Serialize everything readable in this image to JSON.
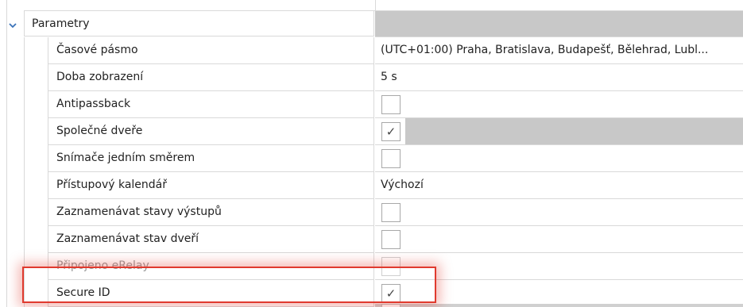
{
  "section": {
    "title": "Parametry",
    "expanded": true,
    "chevron_icon": "chevron-down-icon"
  },
  "rows": [
    {
      "key": "timezone",
      "label": "Časové pásmo",
      "type": "text",
      "value": "(UTC+01:00) Praha, Bratislava, Budapešť, Bělehrad, Lubl..."
    },
    {
      "key": "display-time",
      "label": "Doba zobrazení",
      "type": "text",
      "value": "5 s"
    },
    {
      "key": "antipassback",
      "label": "Antipassback",
      "type": "checkbox",
      "checked": false
    },
    {
      "key": "shared-door",
      "label": "Společné dveře",
      "type": "checkbox",
      "checked": true,
      "shaded": true
    },
    {
      "key": "one-way-readers",
      "label": "Snímače jedním směrem",
      "type": "checkbox",
      "checked": false
    },
    {
      "key": "access-calendar",
      "label": "Přístupový kalendář",
      "type": "text",
      "value": "Výchozí"
    },
    {
      "key": "log-output-states",
      "label": "Zaznamenávat stavy výstupů",
      "type": "checkbox",
      "checked": false
    },
    {
      "key": "log-door-state",
      "label": "Zaznamenávat stav dveří",
      "type": "checkbox",
      "checked": false
    },
    {
      "key": "erelay-connected",
      "label": "Připojeno eRelay",
      "type": "checkbox",
      "checked": false,
      "faded": true
    },
    {
      "key": "secure-id",
      "label": "Secure ID",
      "type": "checkbox",
      "checked": true
    }
  ],
  "check_glyph": "✓",
  "colors": {
    "highlight": "#e03a2e",
    "chevron": "#3b73b9",
    "shaded_cell": "#c8c8c8",
    "grid_line": "#d9d9d9"
  }
}
